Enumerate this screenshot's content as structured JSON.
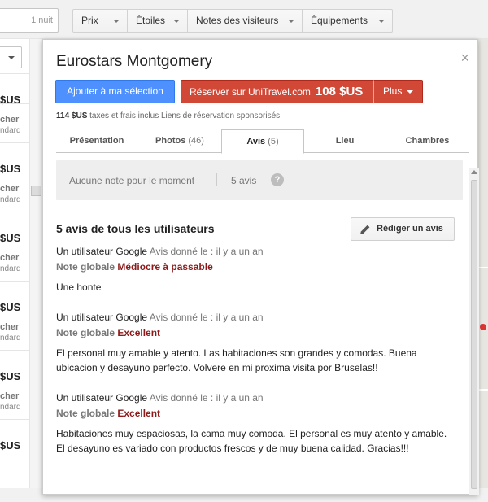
{
  "topbar": {
    "nights_label": "1 nuit",
    "filters": [
      {
        "label": "Prix"
      },
      {
        "label": "Étoiles"
      },
      {
        "label": "Notes des visiteurs"
      },
      {
        "label": "Équipements"
      }
    ]
  },
  "leftlist": {
    "items": [
      {
        "price": "$US",
        "line1": "cher",
        "line2": "ndard"
      },
      {
        "price": "$US",
        "line1": "cher",
        "line2": "ndard"
      },
      {
        "price": "$US",
        "line1": "cher",
        "line2": "ndard"
      },
      {
        "price": "$US",
        "line1": "cher",
        "line2": "ndard"
      },
      {
        "price": "$US",
        "line1": "cher",
        "line2": "ndard"
      },
      {
        "price": "$US",
        "line1": "",
        "line2": ""
      }
    ]
  },
  "panel": {
    "title": "Eurostars Montgomery",
    "close_glyph": "×",
    "add_label": "Ajouter à ma sélection",
    "book_label": "Réserver sur UniTravel.com",
    "book_price": "108 $US",
    "more_label": "Plus",
    "tax_amount": "114 $US",
    "tax_text": "taxes et frais inclus Liens de réservation sponsorisés",
    "tabs": [
      {
        "label": "Présentation",
        "count": ""
      },
      {
        "label": "Photos",
        "count": "(46)"
      },
      {
        "label": "Avis",
        "count": "(5)"
      },
      {
        "label": "Lieu",
        "count": ""
      },
      {
        "label": "Chambres",
        "count": ""
      }
    ],
    "summary": {
      "no_rating": "Aucune note pour le moment",
      "review_count": "5 avis",
      "help_glyph": "?"
    },
    "reviews_heading": "5 avis de tous les utilisateurs",
    "write_review_label": "Rédiger un avis",
    "reviews": [
      {
        "author": "Un utilisateur Google",
        "when": "Avis donné le : il y a un an",
        "rating_label": "Note globale",
        "rating_value": "Médiocre à passable",
        "text": "Une honte"
      },
      {
        "author": "Un utilisateur Google",
        "when": "Avis donné le : il y a un an",
        "rating_label": "Note globale",
        "rating_value": "Excellent",
        "text": "El personal muy amable y atento. Las habitaciones son grandes y comodas. Buena ubicacion y desayuno perfecto. Volvere en mi proxima visita por Bruselas!!"
      },
      {
        "author": "Un utilisateur Google",
        "when": "Avis donné le : il y a un an",
        "rating_label": "Note globale",
        "rating_value": "Excellent",
        "text": "Habitaciones muy espaciosas, la cama muy comoda. El personal es muy atento y amable. El desayuno es variado con productos frescos y de muy buena calidad. Gracias!!!"
      }
    ]
  },
  "colors": {
    "primary_blue": "#4d90fe",
    "book_red": "#d14836",
    "rating_red": "#8c1a1a"
  }
}
